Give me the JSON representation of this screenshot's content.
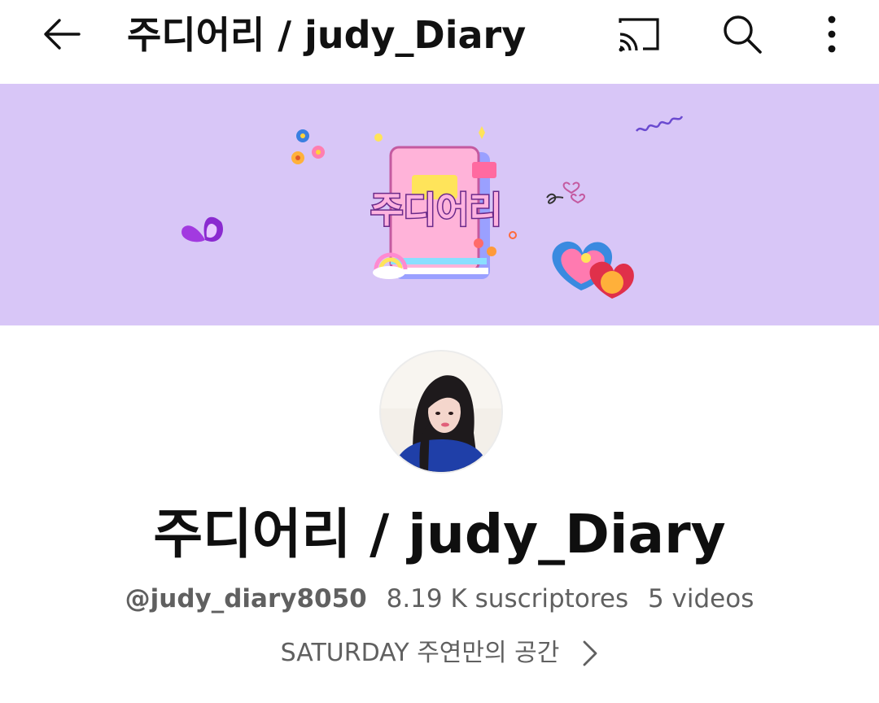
{
  "header": {
    "title": "주디어리 / judy_Diary",
    "icons": {
      "back": "arrow-left-icon",
      "cast": "cast-icon",
      "search": "search-icon",
      "more": "more-vertical-icon"
    }
  },
  "banner": {
    "logo_text": "주디어리",
    "background": "#d8c6f7"
  },
  "channel": {
    "name": "주디어리 / judy_Diary",
    "handle": "@judy_diary8050",
    "subscribers": "8.19 K suscriptores",
    "videos": "5 videos",
    "description": "SATURDAY 주연만의 공간"
  },
  "colors": {
    "text_primary": "#0f0f0f",
    "text_secondary": "#606060",
    "banner_bg": "#d8c6f7"
  }
}
